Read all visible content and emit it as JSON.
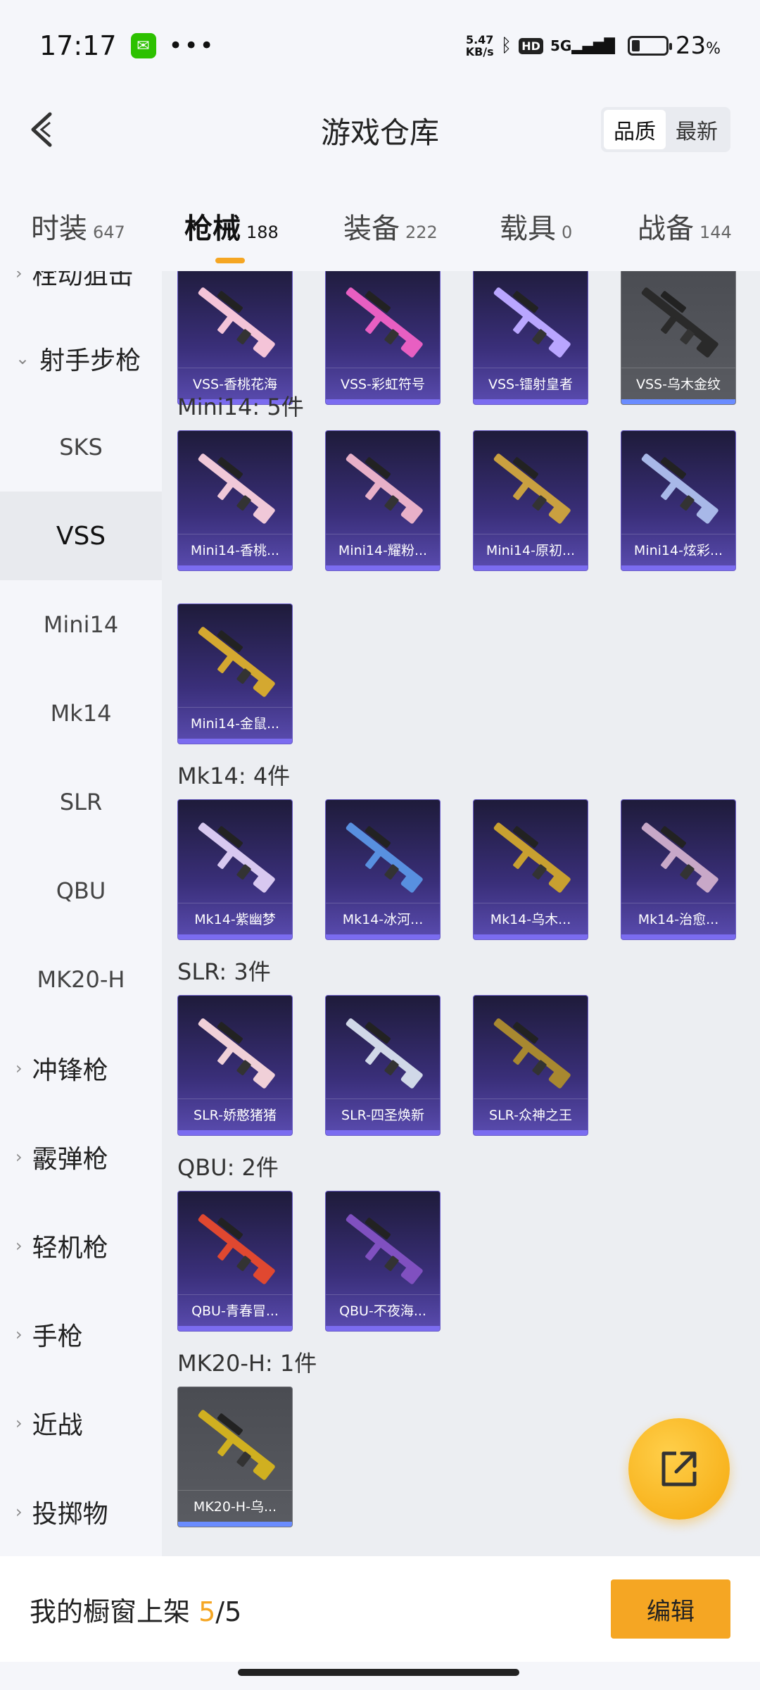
{
  "status_bar": {
    "time": "17:17",
    "dots": "•••",
    "net_speed_value": "5.47",
    "net_speed_unit": "KB/s",
    "hd": "HD",
    "signal": "5G",
    "battery_percent": 23,
    "battery_text": "23",
    "battery_unit": "%"
  },
  "header": {
    "title": "游戏仓库",
    "sort_options": [
      "品质",
      "最新"
    ],
    "active_sort": "品质"
  },
  "tabs": [
    {
      "label": "时装",
      "count": "647"
    },
    {
      "label": "枪械",
      "count": "188",
      "active": true
    },
    {
      "label": "装备",
      "count": "222"
    },
    {
      "label": "载具",
      "count": "0"
    },
    {
      "label": "战备",
      "count": "144"
    }
  ],
  "sidebar": {
    "items": [
      {
        "label": "栓动狙击",
        "type": "group",
        "partial": true
      },
      {
        "label": "射手步枪",
        "type": "group",
        "expanded": true
      },
      {
        "label": "SKS"
      },
      {
        "label": "VSS",
        "active": true
      },
      {
        "label": "Mini14"
      },
      {
        "label": "Mk14"
      },
      {
        "label": "SLR"
      },
      {
        "label": "QBU"
      },
      {
        "label": "MK20-H"
      },
      {
        "label": "冲锋枪",
        "type": "group"
      },
      {
        "label": "霰弹枪",
        "type": "group"
      },
      {
        "label": "轻机枪",
        "type": "group"
      },
      {
        "label": "手枪",
        "type": "group"
      },
      {
        "label": "近战",
        "type": "group"
      },
      {
        "label": "投掷物",
        "type": "group"
      }
    ]
  },
  "sections": [
    {
      "title": "",
      "items": [
        "VSS-香桃花海",
        "VSS-彩虹符号",
        "VSS-镭射皇者",
        "VSS-乌木金纹"
      ]
    },
    {
      "title": "Mini14: 5件",
      "items": [
        "Mini14-香桃...",
        "Mini14-耀粉...",
        "Mini14-原初...",
        "Mini14-炫彩...",
        "Mini14-金鼠..."
      ]
    },
    {
      "title": "Mk14: 4件",
      "items": [
        "Mk14-紫幽梦",
        "Mk14-冰河...",
        "Mk14-乌木...",
        "Mk14-治愈..."
      ]
    },
    {
      "title": "SLR: 3件",
      "items": [
        "SLR-娇憨猪猪",
        "SLR-四圣焕新",
        "SLR-众神之王"
      ]
    },
    {
      "title": "QBU: 2件",
      "items": [
        "QBU-青春冒...",
        "QBU-不夜海..."
      ]
    },
    {
      "title": "MK20-H: 1件",
      "items": [
        "MK20-H-乌..."
      ]
    }
  ],
  "bottom_bar": {
    "label": "我的橱窗上架",
    "current": "5",
    "total": "/5",
    "edit_label": "编辑"
  },
  "colors": {
    "accent": "#f5a623",
    "card_purple": "#3a2f7a",
    "card_grey": "#55575d"
  }
}
